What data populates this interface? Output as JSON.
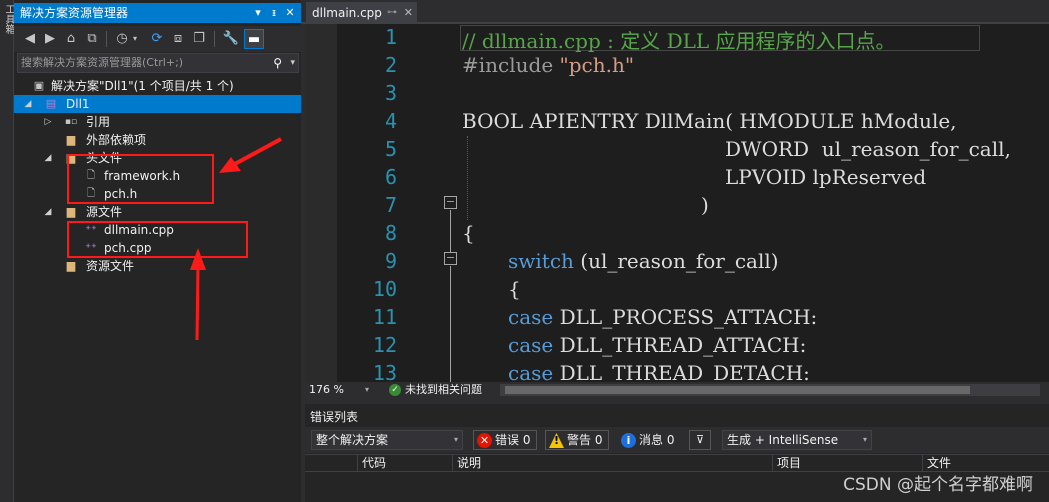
{
  "toolbox": {
    "label": "工具箱"
  },
  "solution_explorer": {
    "title": "解决方案资源管理器",
    "title_buttons": {
      "dropdown": "▾",
      "pin": "ᵻ",
      "close": "✕"
    },
    "search_placeholder": "搜索解决方案资源管理器(Ctrl+;)",
    "tree": {
      "solution": "解决方案\"Dll1\"(1 个项目/共 1 个)",
      "project": "Dll1",
      "references": "引用",
      "external_deps": "外部依赖项",
      "header_files": "头文件",
      "framework_h": "framework.h",
      "pch_h": "pch.h",
      "source_files": "源文件",
      "dllmain_cpp": "dllmain.cpp",
      "pch_cpp": "pch.cpp",
      "resource_files": "资源文件"
    }
  },
  "editor": {
    "tab_label": "dllmain.cpp",
    "line_numbers": [
      "1",
      "2",
      "3",
      "4",
      "5",
      "6",
      "7",
      "8",
      "9",
      "10",
      "11",
      "12",
      "13"
    ],
    "code": {
      "l1": "// dllmain.cpp : 定义 DLL 应用程序的入口点。",
      "l2_pre": "#include ",
      "l2_str": "\"pch.h\"",
      "l4_a": "BOOL APIENTRY DllMain( HMODULE hModule,",
      "l5": "DWORD  ul_reason_for_call,",
      "l6": "LPVOID lpReserved",
      "l7": ")",
      "l8": "{",
      "l9_kw": "switch",
      "l9_rest": " (ul_reason_for_call)",
      "l10": "{",
      "l11_kw": "case",
      "l11_rest": " DLL_PROCESS_ATTACH:",
      "l12_kw": "case",
      "l12_rest": " DLL_THREAD_ATTACH:",
      "l13_kw": "case",
      "l13_rest": " DLL_THREAD_DETACH:"
    },
    "zoom": "176 %",
    "status": "未找到相关问题"
  },
  "error_list": {
    "title": "错误列表",
    "scope": "整个解决方案",
    "errors": "错误 0",
    "warnings": "警告 0",
    "messages": "消息 0",
    "build_filter": "生成 + IntelliSense",
    "columns": {
      "code": "代码",
      "description": "说明",
      "project": "项目",
      "file": "文件"
    }
  },
  "watermark": "CSDN @起个名字都难啊",
  "colors": {
    "accent": "#007acc",
    "annotation": "#ff1a1a"
  }
}
